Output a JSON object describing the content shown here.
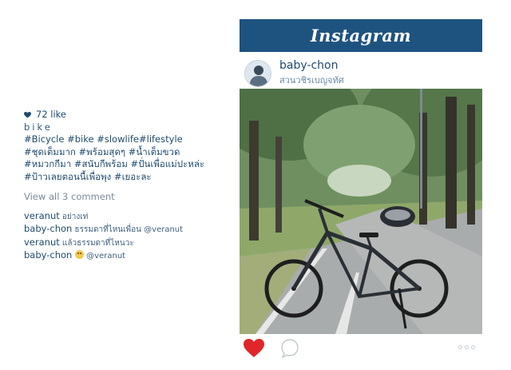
{
  "caption": {
    "likes": "72 like",
    "title": "bike",
    "tags": [
      "#Bicycle #bike #slowlife#lifestyle",
      "#ชุดเต็มมาก #พร้อมสุดๆ #น้ำเต็มขวด",
      "#หมวกกีมา #สนับกีพร้อม #ปั่นเพื่อแม่ปะหล่ะ",
      "#ป้าวเลยตอนนี้เพื่อพุง #เยอะละ"
    ],
    "view_all": "View all 3 comment",
    "comments": [
      {
        "user": "veranut",
        "text": " อย่างเท่"
      },
      {
        "user": "baby-chon",
        "text": "  ธรรมดาที่ไหนเพื่อน @veranut"
      },
      {
        "user": "veranut",
        "text": " แล้วธรรมดาที่ไหนวะ"
      },
      {
        "user": "baby-chon",
        "text": " @veranut"
      }
    ]
  },
  "header": {
    "logo": "Instagram",
    "color": "#1e5380"
  },
  "profile": {
    "username": "baby-chon",
    "location": "สวนวชิรเบญจทัศ"
  },
  "icons": {
    "likes": "heart-icon",
    "like_button": "heart-icon",
    "comment_button": "speech-bubble-icon",
    "more_button": "dots-icon"
  },
  "colors": {
    "heart": "#e0262b",
    "text": "#1f4a6e",
    "muted": "#7b8a99"
  }
}
